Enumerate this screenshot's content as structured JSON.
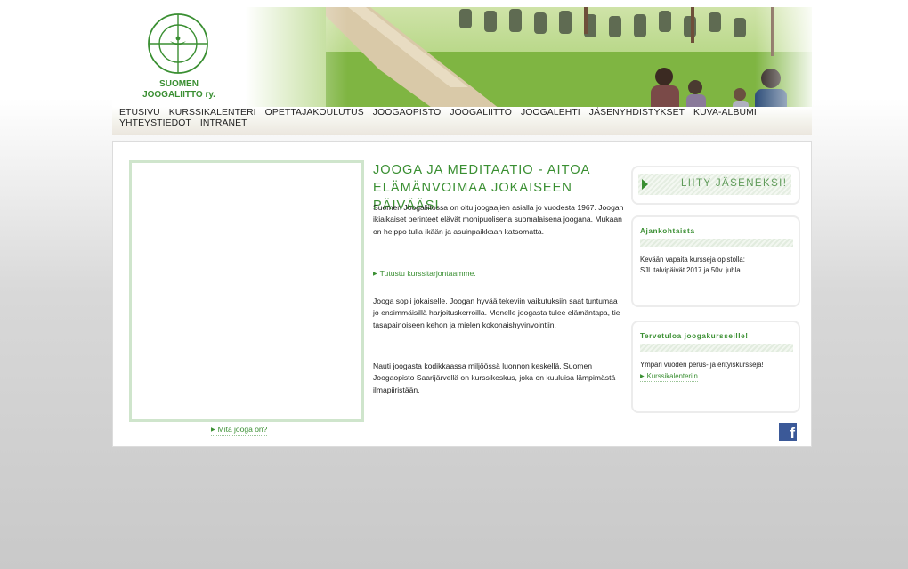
{
  "logo": {
    "line1": "SUOMEN",
    "line2": "JOOGALIITTO ry."
  },
  "nav": {
    "items": [
      "ETUSIVU",
      "KURSSIKALENTERI",
      "OPETTAJAKOULUTUS",
      "JOOGAOPISTO",
      "JOOGALIITTO",
      "JOOGALEHTI",
      "JÄSENYHDISTYKSET",
      "KUVA-ALBUMI",
      "YHTEYSTIEDOT",
      "INTRANET"
    ]
  },
  "video": {
    "link": "Mitä jooga on?"
  },
  "main": {
    "title": "JOOGA JA MEDITAATIO - AITOA ELÄMÄNVOIMAA JOKAISEEN PÄIVÄÄSI",
    "para1": "Suomen Joogaliitossa on oltu joogaajien asialla jo vuodesta 1967. Joogan ikiaikaiset perinteet elävät monipuolisena suomalaisena joogana. Mukaan on helppo tulla ikään ja asuinpaikkaan katsomatta.",
    "link": "Tutustu kurssitarjontaamme.",
    "para2": "Jooga sopii jokaiselle. Joogan hyvää tekeviin vaikutuksiin saat tuntumaa jo ensimmäisillä harjoituskerroilla. Monelle joogasta tulee elämäntapa, tie tasapainoiseen kehon ja mielen kokonaishyvinvointiin.",
    "para3": "Nauti joogasta kodikkaassa miljöössä luonnon keskellä. Suomen Joogaopisto Saarijärvellä on kurssikeskus, joka on kuuluisa lämpimästä ilmapiiristään."
  },
  "sidebar": {
    "join_label": "LIITY JÄSENEKSI!",
    "news_title": "Ajankohtaista",
    "news_line1": "Kevään vapaita kursseja opistolla:",
    "news_line2": "SJL talvipäivät 2017 ja 50v. juhla",
    "welcome_title": "Tervetuloa joogakursseille!",
    "welcome_text": "Ympäri vuoden perus- ja erityiskursseja!",
    "welcome_link": "Kurssikalenteriin"
  },
  "social": {
    "facebook_icon": "facebook-icon",
    "facebook_glyph": "f"
  },
  "colors": {
    "accent": "#3a8f32",
    "facebook": "#3b5998"
  }
}
